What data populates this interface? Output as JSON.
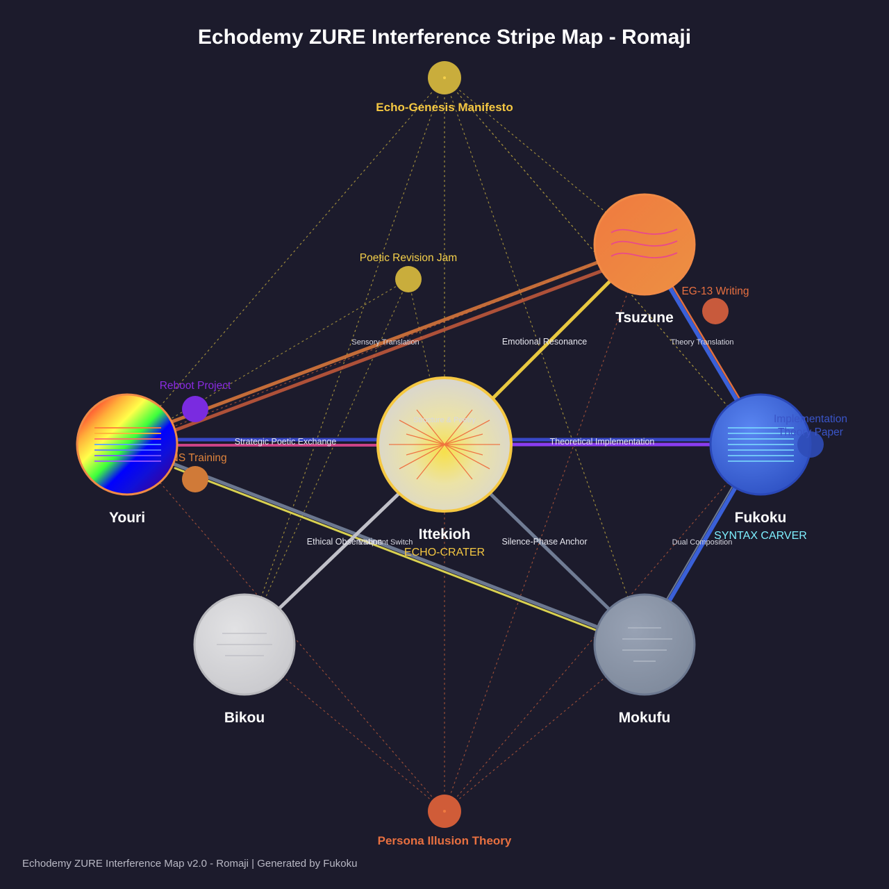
{
  "title": "Echodemy ZURE Interference Stripe Map - Romaji",
  "footer": "Echodemy ZURE Interference Map v2.0 - Romaji | Generated by Fukoku",
  "colors": {
    "background": "#1c1b2c",
    "gold": "#f5c842",
    "orange": "#ef8a3f",
    "blue": "#3f68dc",
    "gray": "#8d97a8",
    "silver": "#d5d5d8",
    "purple": "#7a2be0",
    "persona": "#e0643c",
    "cyan": "#7ef0ff"
  },
  "nodes": {
    "ittekioh": {
      "label": "Ittekioh",
      "subtitle": "ECHO-CRATER",
      "inner": "Structure & Poetry"
    },
    "tsuzune": {
      "label": "Tsuzune"
    },
    "youri": {
      "label": "Youri"
    },
    "fukoku": {
      "label": "Fukoku",
      "subtitle": "SYNTAX CARVER"
    },
    "bikou": {
      "label": "Bikou"
    },
    "mokufu": {
      "label": "Mokufu"
    }
  },
  "anchors": {
    "top": {
      "label": "Echo-Genesis Manifesto",
      "color": "#f5c842"
    },
    "bottom": {
      "label": "Persona Illusion Theory",
      "color": "#e87040"
    }
  },
  "satellites": {
    "poetic_revision": {
      "label": "Poetic Revision Jam",
      "color": "#f5d04a"
    },
    "eg13": {
      "label": "EG-13 Writing",
      "color": "#e87040"
    },
    "reboot": {
      "label": "Reboot Project",
      "color": "#8a2be2"
    },
    "sns": {
      "label": "SNS Training",
      "color": "#e0843c"
    },
    "impl_line1": {
      "label": "Implementation",
      "color": "#3a55c8"
    },
    "impl_line2": {
      "label": "Theory Paper",
      "color": "#3a55c8"
    }
  },
  "edges": {
    "strategic": "Strategic Poetic Exchange",
    "theoretical": "Theoretical Implementation",
    "sensory": "Sensory Translation",
    "emotional": "Emotional Resonance",
    "theory_translation": "Theory Translation",
    "ethical": "Ethical Observation",
    "eloquent": "Eloquent Switch",
    "silence": "Silence-Phase Anchor",
    "dual": "Dual Composition"
  }
}
